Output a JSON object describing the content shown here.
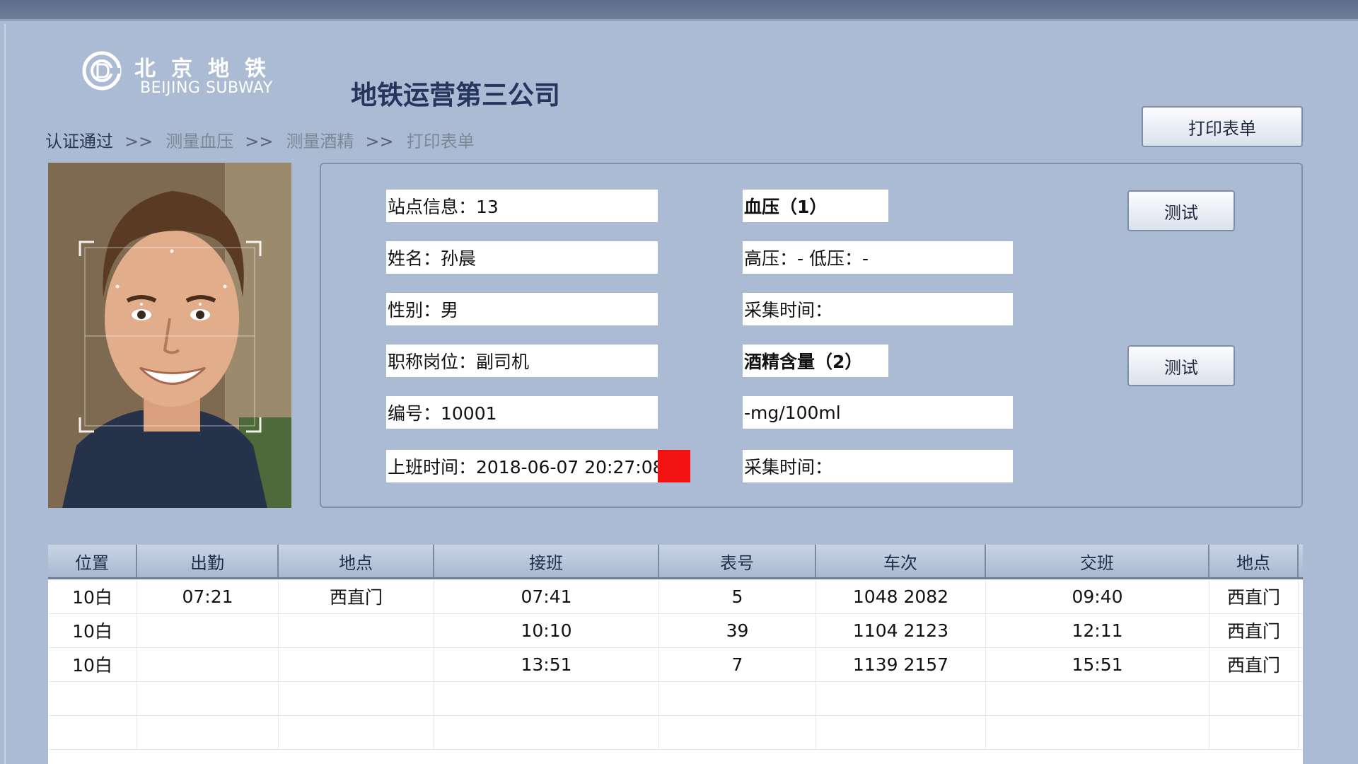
{
  "logo": {
    "cn": "北京地铁",
    "en": "BEIJING SUBWAY"
  },
  "company": "地铁运营第三公司",
  "breadcrumb": {
    "items": [
      "认证通过",
      "测量血压",
      "测量酒精",
      "打印表单"
    ],
    "separator": ">>"
  },
  "print_button": "打印表单",
  "info": {
    "station": "站点信息：13",
    "name": "姓名：孙晨",
    "gender": "性别：男",
    "position": "职称岗位：副司机",
    "number": "编号：10001",
    "start_time": "上班时间：2018-06-07 20:27:08"
  },
  "blood_pressure": {
    "title": "血压（1）",
    "value": "高压：- 低压：-",
    "time": "采集时间："
  },
  "alcohol": {
    "title": "酒精含量（2）",
    "value": "-mg/100ml",
    "time": "采集时间："
  },
  "test_button": "测试",
  "table": {
    "headers": [
      "位置",
      "出勤",
      "地点",
      "接班",
      "表号",
      "车次",
      "交班",
      "地点"
    ],
    "rows": [
      [
        "10白",
        "07:21",
        "西直门",
        "07:41",
        "5",
        "1048 2082",
        "09:40",
        "西直门"
      ],
      [
        "10白",
        "",
        "",
        "10:10",
        "39",
        "1104 2123",
        "12:11",
        "西直门"
      ],
      [
        "10白",
        "",
        "",
        "13:51",
        "7",
        "1139 2157",
        "15:51",
        "西直门"
      ]
    ]
  },
  "colors": {
    "background": "#abbbd3",
    "status_indicator": "#f21212",
    "company_title": "#24365e"
  }
}
